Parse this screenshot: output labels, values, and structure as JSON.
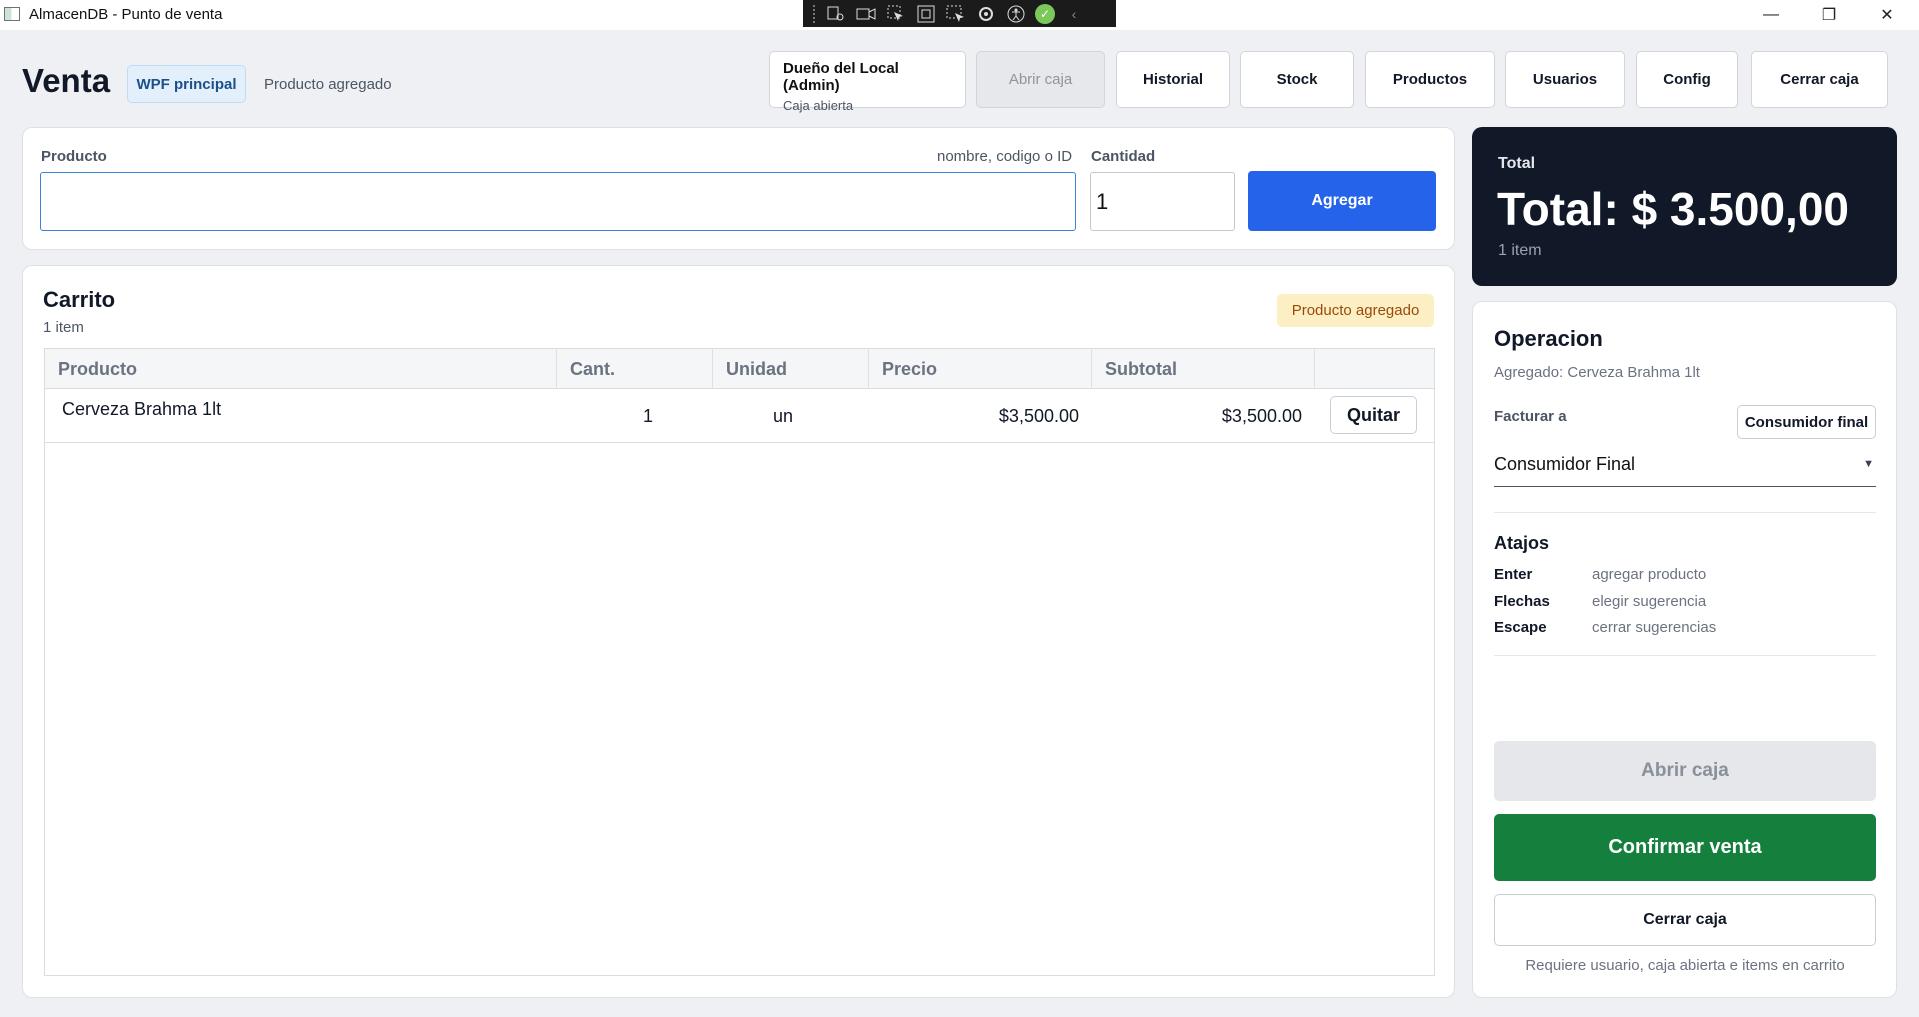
{
  "window": {
    "title": "AlmacenDB - Punto de venta",
    "controls": [
      "—",
      "❐",
      "✕"
    ]
  },
  "header": {
    "title": "Venta",
    "chip": "WPF principal",
    "status": "Producto agregado",
    "user": {
      "name": "Dueño del Local (Admin)",
      "caja": "Caja abierta"
    },
    "buttons": {
      "abrir_caja": "Abrir caja",
      "historial": "Historial",
      "stock": "Stock",
      "productos": "Productos",
      "usuarios": "Usuarios",
      "config": "Config",
      "cerrar_caja": "Cerrar caja"
    }
  },
  "search": {
    "product_label": "Producto",
    "product_hint": "nombre, codigo o ID",
    "product_value": "",
    "qty_label": "Cantidad",
    "qty_value": "1",
    "add_button": "Agregar"
  },
  "cart": {
    "title": "Carrito",
    "count": "1 item",
    "badge": "Producto agregado",
    "columns": [
      "Producto",
      "Cant.",
      "Unidad",
      "Precio",
      "Subtotal",
      ""
    ],
    "rows": [
      {
        "producto": "Cerveza Brahma 1lt",
        "cant": "1",
        "unidad": "un",
        "precio": "$3,500.00",
        "subtotal": "$3,500.00",
        "action": "Quitar"
      }
    ]
  },
  "total": {
    "label": "Total",
    "value": "Total: $ 3.500,00",
    "count": "1 item"
  },
  "operacion": {
    "title": "Operacion",
    "subtitle": "Agregado: Cerveza Brahma 1lt",
    "facturar_label": "Facturar a",
    "consumidor_button": "Consumidor final",
    "select_value": "Consumidor Final",
    "atajos_title": "Atajos",
    "shortcuts": [
      {
        "key": "Enter",
        "desc": "agregar producto"
      },
      {
        "key": "Flechas",
        "desc": "elegir sugerencia"
      },
      {
        "key": "Escape",
        "desc": "cerrar sugerencias"
      }
    ],
    "abrir_caja": "Abrir caja",
    "confirmar": "Confirmar venta",
    "cerrar_caja": "Cerrar caja",
    "requirement": "Requiere usuario, caja abierta e items en carrito"
  },
  "colors": {
    "primary": "#2563eb",
    "confirm": "#15803d",
    "total_bg": "#111827",
    "badge_bg": "#fdefc4"
  }
}
